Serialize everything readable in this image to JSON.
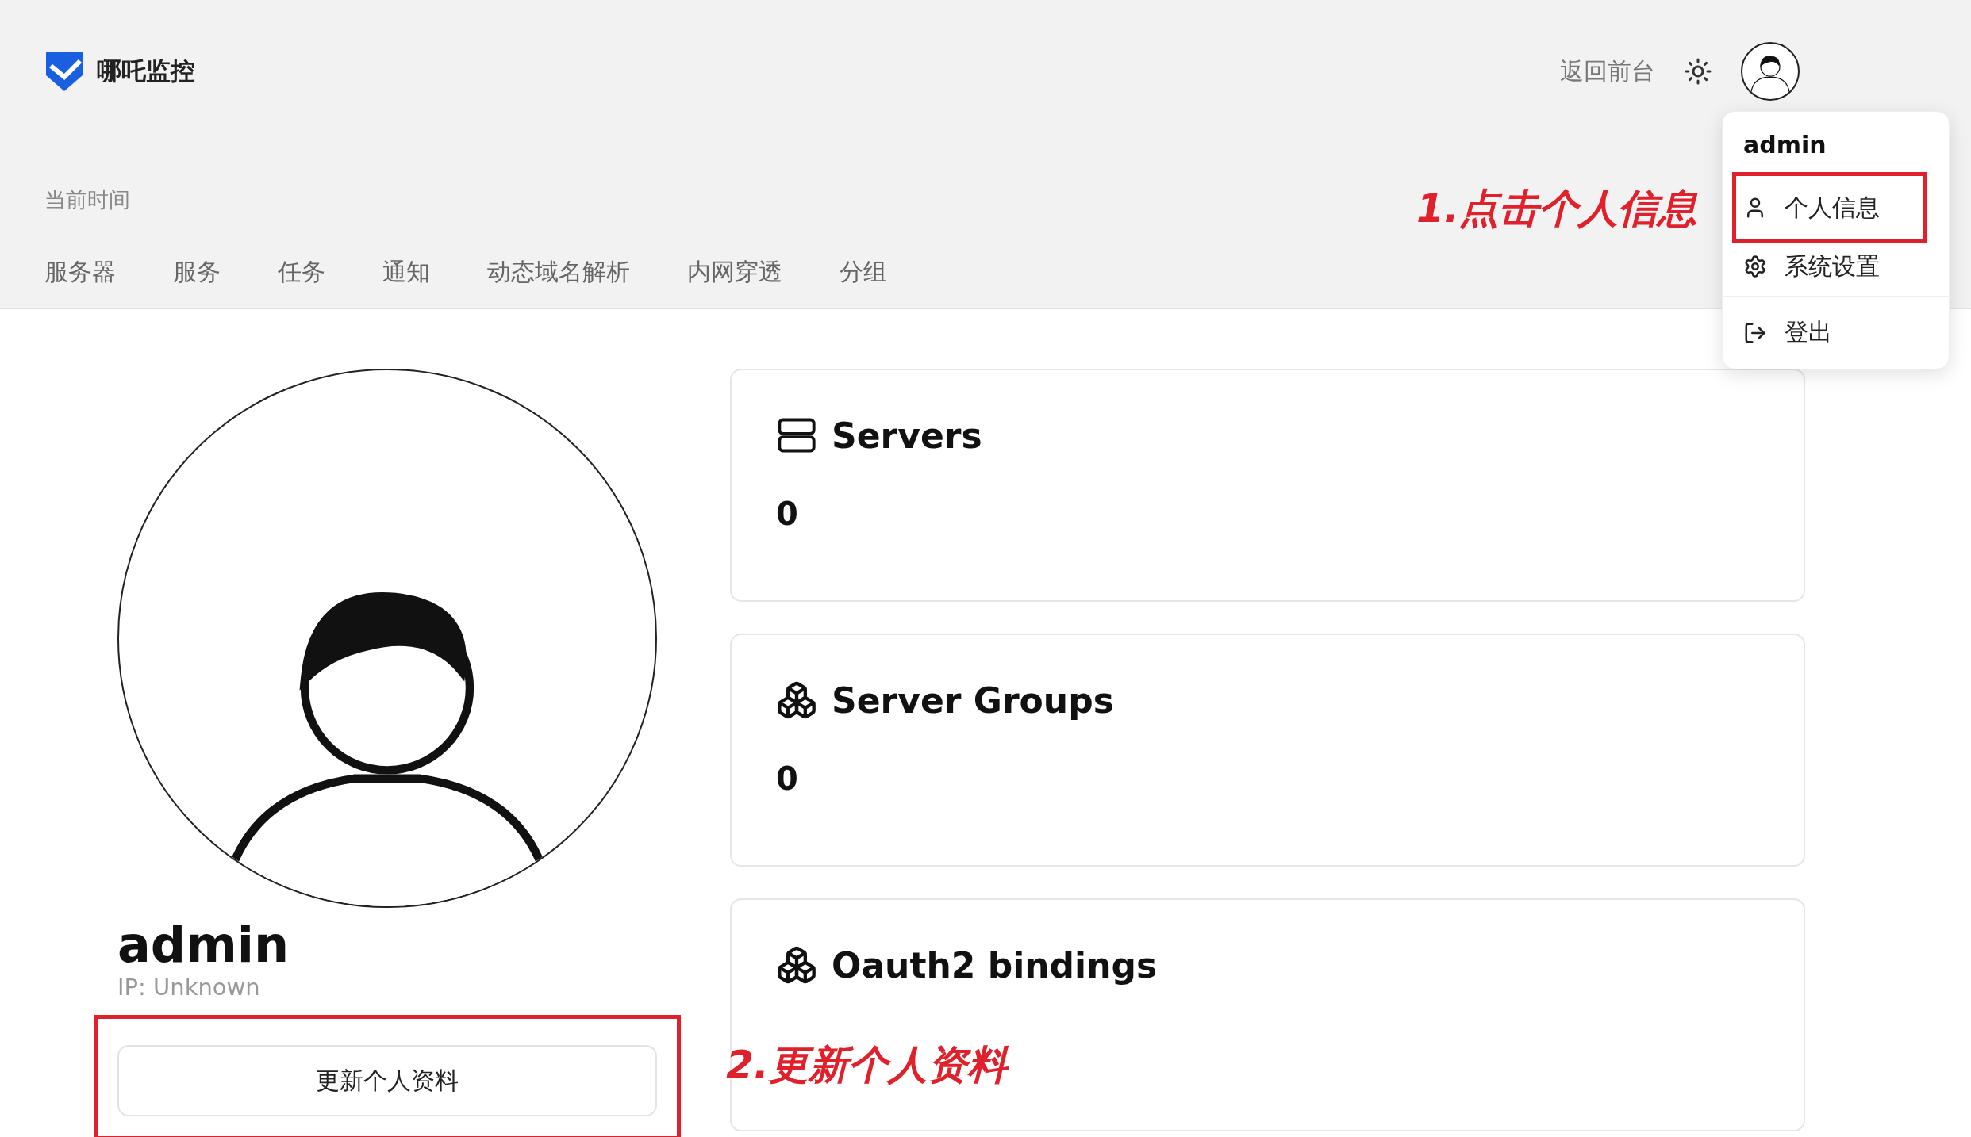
{
  "header": {
    "logo": "哪吒监控",
    "clock_label": "当前时间",
    "back_link": "返回前台"
  },
  "nav": [
    "服务器",
    "服务",
    "任务",
    "通知",
    "动态域名解析",
    "内网穿透",
    "分组"
  ],
  "profile": {
    "name": "admin",
    "ip": "IP: Unknown",
    "update_button": {
      "label": "更新个人资料",
      "highlighted": true
    }
  },
  "cards": [
    {
      "kind": "servers",
      "title": "Servers",
      "value": "0"
    },
    {
      "kind": "groups",
      "title": "Server Groups",
      "value": "0"
    },
    {
      "kind": "groups",
      "title": "Oauth2 bindings"
    }
  ],
  "user_menu": {
    "username": "admin",
    "items": [
      {
        "kind": "user",
        "label": "个人信息",
        "highlighted": true
      },
      {
        "kind": "settings",
        "label": "系统设置",
        "highlighted": false
      },
      {
        "kind": "logout",
        "label": "登出",
        "highlighted": false
      }
    ]
  },
  "annotations": [
    {
      "text": "1.点击个人信息"
    },
    {
      "text": "2.更新个人资料"
    }
  ]
}
